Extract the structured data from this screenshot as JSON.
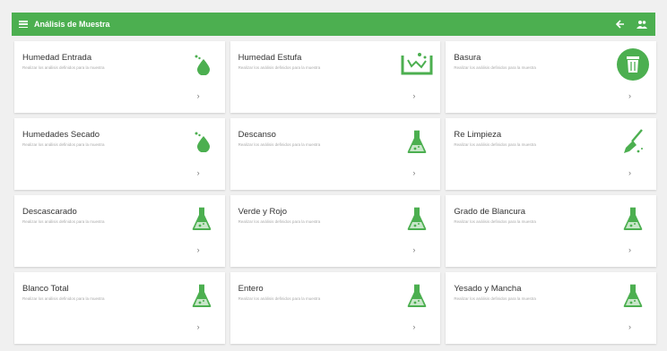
{
  "appbar": {
    "title": "Análisis de Muestra",
    "back_icon": "arrow-left-icon",
    "user_icon": "users-icon",
    "color": "#4caf50"
  },
  "cards": [
    {
      "title": "Humedad Entrada",
      "subtitle": "Realizar los análisis definidos para la muestra",
      "icon": "droplet-icon",
      "chevron": "›"
    },
    {
      "title": "Humedad Estufa",
      "subtitle": "Realizar los análisis definidos para la muestra",
      "icon": "tray-icon",
      "chevron": "›"
    },
    {
      "title": "Basura",
      "subtitle": "Realizar los análisis definidos para la muestra",
      "icon": "trash-icon",
      "chevron": "›"
    },
    {
      "title": "Humedades Secado",
      "subtitle": "Realizar los análisis definidos para la muestra",
      "icon": "droplet-icon",
      "chevron": "›"
    },
    {
      "title": "Descanso",
      "subtitle": "Realizar los análisis definidos para la muestra",
      "icon": "flask-icon",
      "chevron": "›"
    },
    {
      "title": "Re Limpieza",
      "subtitle": "Realizar los análisis definidos para la muestra",
      "icon": "broom-icon",
      "chevron": "›"
    },
    {
      "title": "Descascarado",
      "subtitle": "Realizar los análisis definidos para la muestra",
      "icon": "flask-icon",
      "chevron": "›"
    },
    {
      "title": "Verde y Rojo",
      "subtitle": "Realizar los análisis definidos para la muestra",
      "icon": "flask-icon",
      "chevron": "›"
    },
    {
      "title": "Grado de Blancura",
      "subtitle": "Realizar los análisis definidos para la muestra",
      "icon": "flask-icon",
      "chevron": "›"
    },
    {
      "title": "Blanco Total",
      "subtitle": "Realizar los análisis definidos para la muestra",
      "icon": "flask-icon",
      "chevron": "›"
    },
    {
      "title": "Entero",
      "subtitle": "Realizar los análisis definidos para la muestra",
      "icon": "flask-icon",
      "chevron": "›"
    },
    {
      "title": "Yesado y Mancha",
      "subtitle": "Realizar los análisis definidos para la muestra",
      "icon": "flask-icon",
      "chevron": "›"
    }
  ]
}
